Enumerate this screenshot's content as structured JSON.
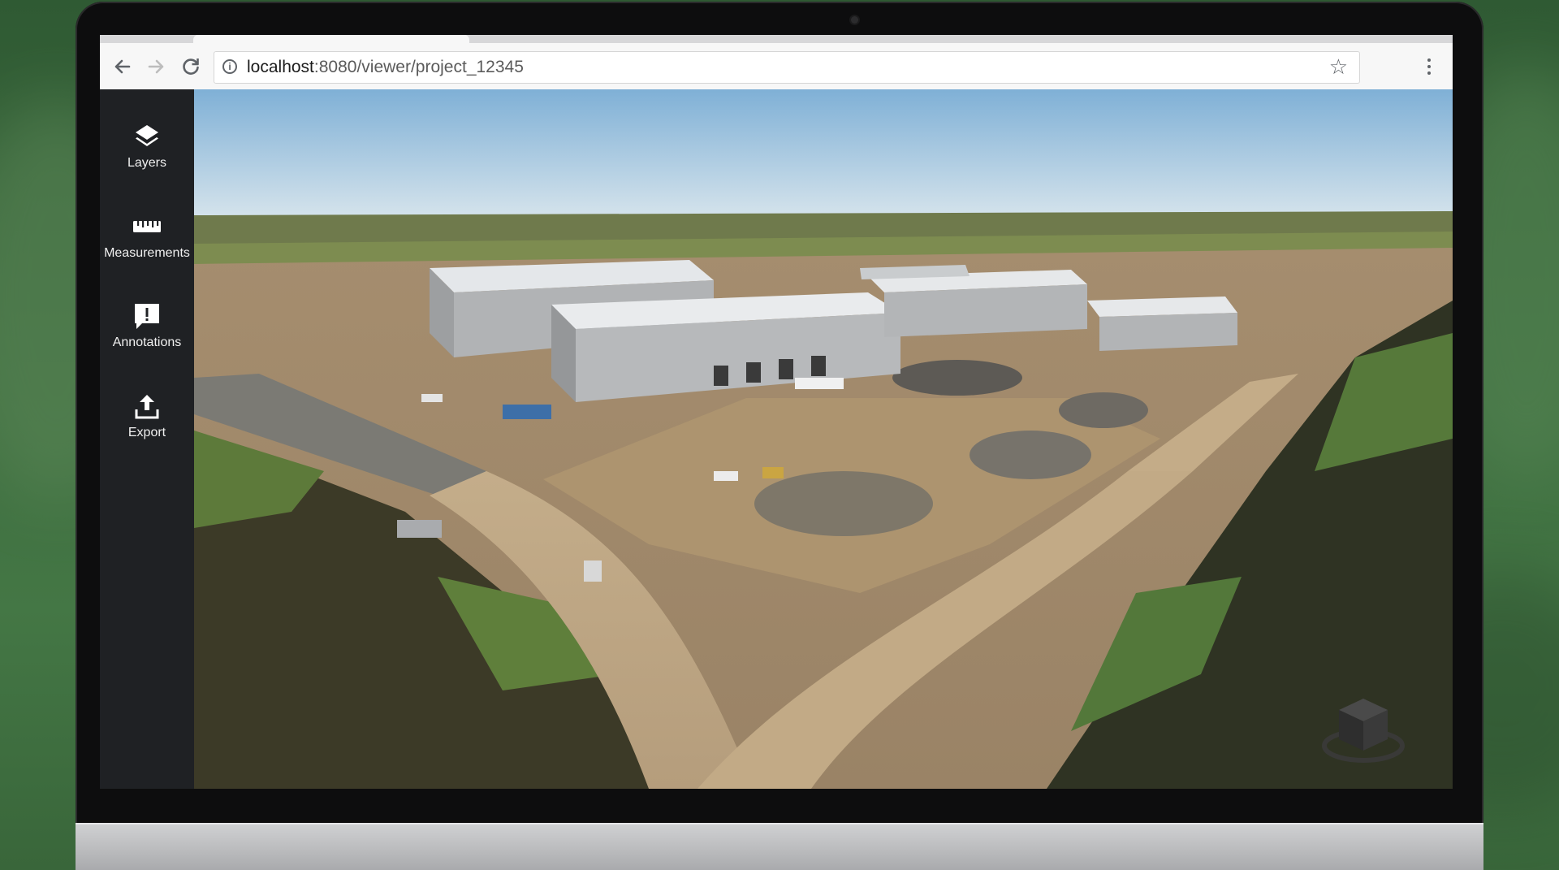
{
  "browser": {
    "url_host": "localhost",
    "url_path": ":8080/viewer/project_12345",
    "icons": {
      "back": "arrow-left-icon",
      "forward": "arrow-right-icon",
      "reload": "reload-icon",
      "info": "info-icon",
      "bookmark": "star-icon",
      "menu": "more-vertical-icon"
    }
  },
  "sidebar": {
    "items": [
      {
        "label": "Layers",
        "icon": "layers-icon"
      },
      {
        "label": "Measurements",
        "icon": "ruler-icon"
      },
      {
        "label": "Annotations",
        "icon": "annotation-icon"
      },
      {
        "label": "Export",
        "icon": "export-icon"
      }
    ]
  },
  "viewer": {
    "scene": "aerial-construction-site-point-cloud",
    "navcube_icon": "view-cube-icon"
  },
  "colors": {
    "sidebar_bg": "#1f2124",
    "sidebar_text": "#f0f0f0",
    "sky_top": "#7fb0d6",
    "dirt": "#b39a78"
  }
}
